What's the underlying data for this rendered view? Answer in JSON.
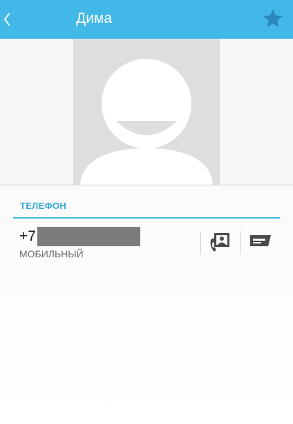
{
  "actionbar": {
    "title": "Дима",
    "back_icon": "chevron-left-icon",
    "favorite_icon": "star-icon",
    "accent_color": "#41b8e8"
  },
  "contact": {
    "photo": "default-avatar-placeholder"
  },
  "section": {
    "title": "ТЕЛЕФОН"
  },
  "phone": {
    "number_prefix": "+7",
    "type": "МОБИЛЬНЫЙ",
    "call_icon": "contact-call-icon",
    "message_icon": "message-icon"
  }
}
